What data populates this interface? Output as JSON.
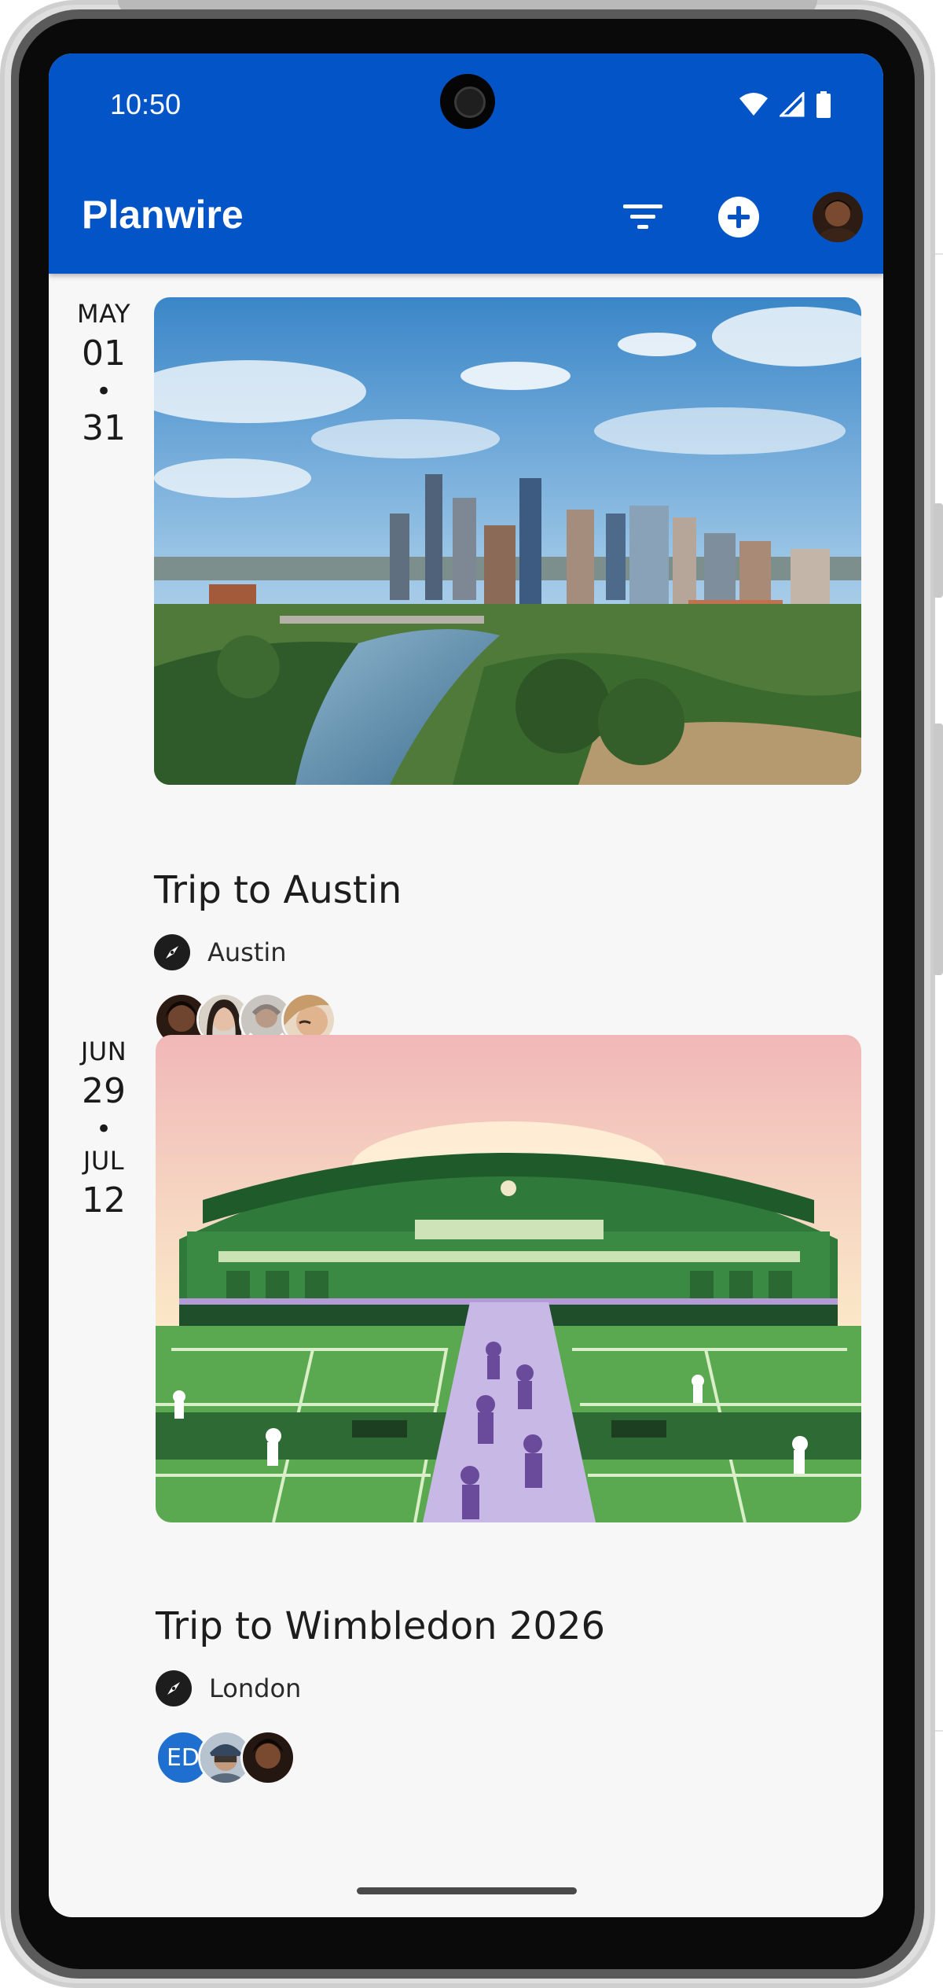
{
  "status_bar": {
    "time": "10:50",
    "icons": [
      "wifi-icon",
      "cellular-signal-icon",
      "battery-icon"
    ]
  },
  "app_bar": {
    "title": "Planwire",
    "actions": [
      "filter-icon",
      "add-circle-icon",
      "profile-avatar"
    ],
    "background_color": "#0354c6"
  },
  "trips": [
    {
      "date_start_month": "MAY",
      "date_start_day": "01",
      "date_separator": "•",
      "date_end_day": "31",
      "image_description": "city-skyline-photo",
      "title": "Trip to Austin",
      "location_icon": "compass-icon",
      "location": "Austin",
      "members": [
        "avatar",
        "avatar",
        "avatar",
        "avatar"
      ]
    },
    {
      "date_start_month": "JUN",
      "date_start_day": "29",
      "date_separator": "•",
      "date_end_month": "JUL",
      "date_end_day": "12",
      "image_description": "tennis-stadium-illustration",
      "title": "Trip to Wimbledon 2026",
      "location_icon": "compass-icon",
      "location": "London",
      "members": [
        {
          "initials": "ED"
        },
        "avatar",
        "avatar"
      ]
    }
  ]
}
